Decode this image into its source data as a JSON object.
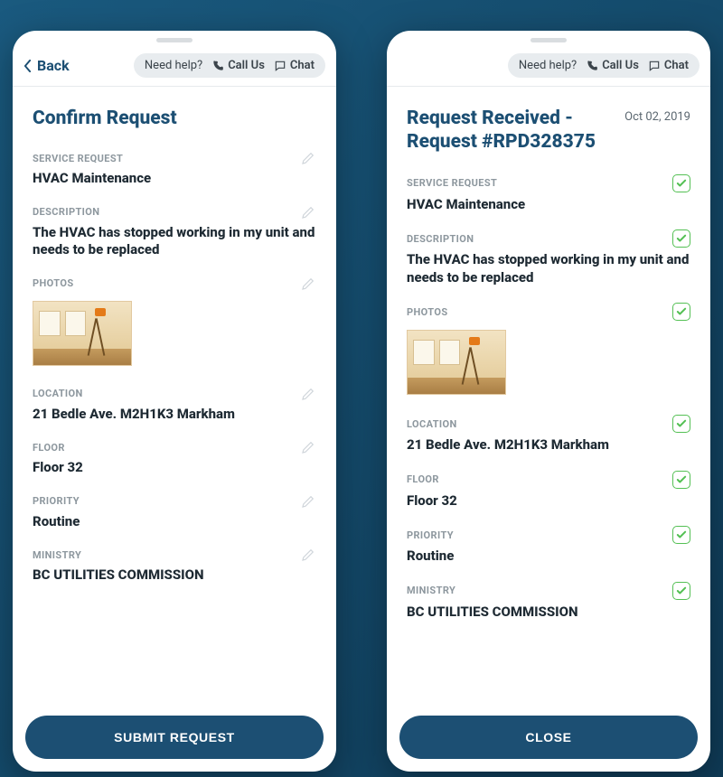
{
  "help": {
    "need_help": "Need help?",
    "call": "Call Us",
    "chat": "Chat"
  },
  "back_label": "Back",
  "screens": {
    "confirm": {
      "title": "Confirm Request",
      "button": "SUBMIT REQUEST",
      "indicator": "edit"
    },
    "received": {
      "title": "Request Received - Request #RPD328375",
      "date": "Oct 02, 2019",
      "button": "CLOSE",
      "indicator": "check"
    }
  },
  "sections": {
    "service_request": {
      "label": "SERVICE REQUEST",
      "value": "HVAC Maintenance"
    },
    "description": {
      "label": "DESCRIPTION",
      "value": "The HVAC has stopped working in my unit and needs to be replaced"
    },
    "photos": {
      "label": "PHOTOS"
    },
    "location": {
      "label": "LOCATION",
      "value": "21 Bedle Ave. M2H1K3 Markham"
    },
    "floor": {
      "label": "FLOOR",
      "value": "Floor 32"
    },
    "priority": {
      "label": "PRIORITY",
      "value": "Routine"
    },
    "ministry": {
      "label": "MINISTRY",
      "value": "BC UTILITIES COMMISSION"
    }
  }
}
